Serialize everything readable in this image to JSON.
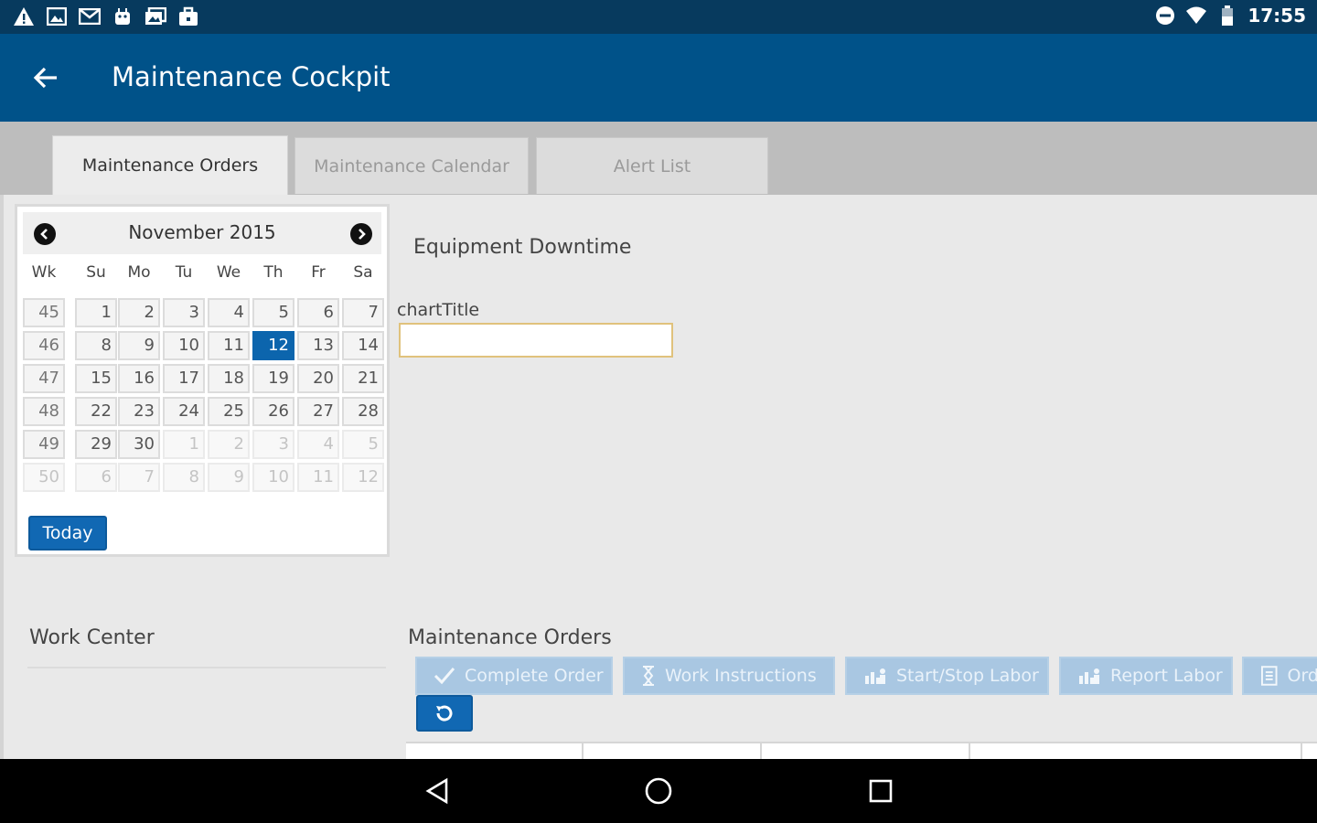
{
  "status_bar": {
    "time": "17:55",
    "left_icons": [
      "warning-icon",
      "image-icon",
      "mail-icon",
      "android-icon",
      "photos-icon",
      "briefcase-icon"
    ],
    "right_icons": [
      "do-not-disturb-icon",
      "wifi-icon",
      "battery-icon"
    ]
  },
  "app_bar": {
    "title": "Maintenance Cockpit"
  },
  "tabs": [
    {
      "label": "Maintenance Orders",
      "active": true
    },
    {
      "label": "Maintenance Calendar",
      "active": false
    },
    {
      "label": "Alert List",
      "active": false
    }
  ],
  "calendar": {
    "month_label": "November 2015",
    "day_headers": [
      "Wk",
      "Su",
      "Mo",
      "Tu",
      "We",
      "Th",
      "Fr",
      "Sa"
    ],
    "weeks": [
      {
        "wk": "45",
        "days": [
          "1",
          "2",
          "3",
          "4",
          "5",
          "6",
          "7"
        ]
      },
      {
        "wk": "46",
        "days": [
          "8",
          "9",
          "10",
          "11",
          "12",
          "13",
          "14"
        ]
      },
      {
        "wk": "47",
        "days": [
          "15",
          "16",
          "17",
          "18",
          "19",
          "20",
          "21"
        ]
      },
      {
        "wk": "48",
        "days": [
          "22",
          "23",
          "24",
          "25",
          "26",
          "27",
          "28"
        ]
      },
      {
        "wk": "49",
        "days": [
          "29",
          "30",
          "1",
          "2",
          "3",
          "4",
          "5"
        ]
      },
      {
        "wk": "50",
        "days": [
          "6",
          "7",
          "8",
          "9",
          "10",
          "11",
          "12"
        ]
      }
    ],
    "selected_day": "12",
    "today_label": "Today"
  },
  "equipment": {
    "title": "Equipment Downtime",
    "chart_title_label": "chartTitle",
    "chart_title_value": ""
  },
  "work_center": {
    "title": "Work Center"
  },
  "orders": {
    "title": "Maintenance Orders",
    "toolbar": [
      {
        "label": "Complete Order",
        "icon": "check-icon"
      },
      {
        "label": "Work Instructions",
        "icon": "hourglass-icon"
      },
      {
        "label": "Start/Stop Labor",
        "icon": "labor-chart-icon"
      },
      {
        "label": "Report Labor",
        "icon": "labor-chart-icon"
      },
      {
        "label": "Ord",
        "icon": "document-icon"
      }
    ],
    "refresh_icon": "refresh-icon"
  },
  "nav_bar": {
    "icons": [
      "nav-back-icon",
      "nav-home-icon",
      "nav-recent-icon"
    ]
  },
  "colors": {
    "status_bar": "#073a5e",
    "app_bar": "#005289",
    "accent": "#1168b3",
    "toolbar_disabled": "#a9c7e2"
  }
}
